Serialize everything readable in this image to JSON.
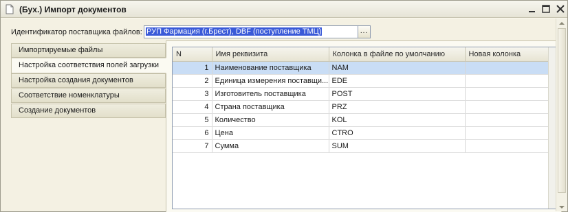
{
  "window": {
    "title": "(Бух.) Импорт документов",
    "icon": "document-icon",
    "controls": {
      "minimize": "minimize-icon",
      "maximize": "maximize-icon",
      "close": "close-icon"
    }
  },
  "supplier_field": {
    "label": "Идентификатор поставщика файлов:",
    "value": "РУП Фармация (г.Брест), DBF (поступление ТМЦ)",
    "button_label": "..."
  },
  "tabs": [
    {
      "label": "Импортируемые файлы",
      "active": false
    },
    {
      "label": "Настройка соответствия полей загрузки",
      "active": true
    },
    {
      "label": "Настройка создания документов",
      "active": false
    },
    {
      "label": "Соответствие номенклатуры",
      "active": false
    },
    {
      "label": "Создание документов",
      "active": false
    }
  ],
  "table": {
    "columns": [
      "N",
      "Имя реквизита",
      "Колонка в файле по умолчанию",
      "Новая колонка"
    ],
    "rows": [
      {
        "n": "1",
        "name": "Наименование поставщика",
        "default_column": "NAM",
        "new_column": ""
      },
      {
        "n": "2",
        "name": "Единица измерения поставщи...",
        "default_column": "EDE",
        "new_column": ""
      },
      {
        "n": "3",
        "name": "Изготовитель поставщика",
        "default_column": "POST",
        "new_column": ""
      },
      {
        "n": "4",
        "name": "Страна поставщика",
        "default_column": "PRZ",
        "new_column": ""
      },
      {
        "n": "5",
        "name": "Количество",
        "default_column": "KOL",
        "new_column": ""
      },
      {
        "n": "6",
        "name": "Цена",
        "default_column": "CTRO",
        "new_column": ""
      },
      {
        "n": "7",
        "name": "Сумма",
        "default_column": "SUM",
        "new_column": ""
      }
    ],
    "selected_row": 1
  },
  "colors": {
    "selection": "#3a5ad8",
    "row_highlight": "#c9ddf5",
    "window_bg": "#f4f1e3"
  }
}
